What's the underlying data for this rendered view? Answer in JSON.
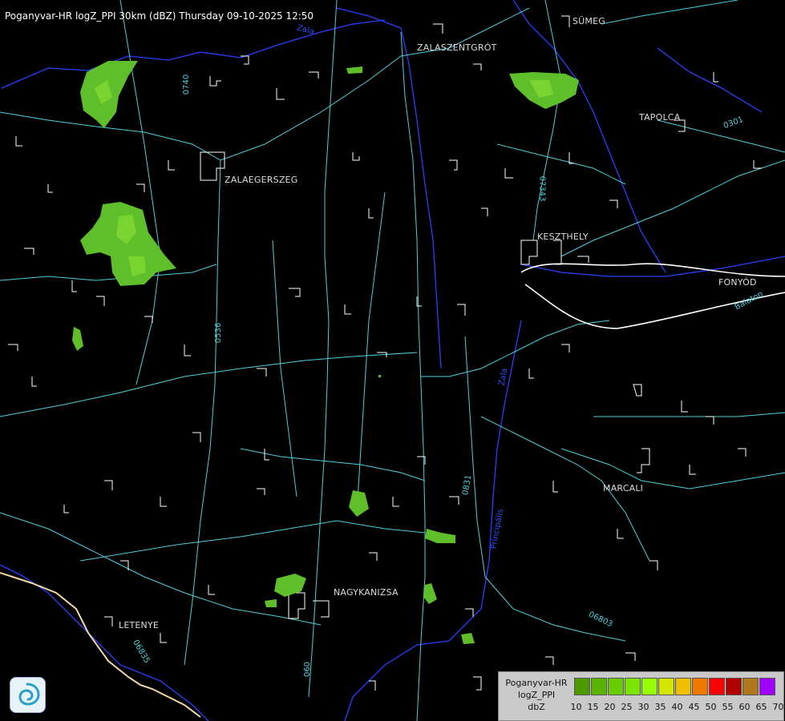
{
  "title": "Poganyvar-HR logZ_PPI 30km (dBZ) Thursday 09-10-2025 12:50",
  "cities": [
    {
      "id": "sumeg",
      "label": "SÜMEG"
    },
    {
      "id": "zalaszentgrot",
      "label": "ZALASZENTGRÓT"
    },
    {
      "id": "tapolca",
      "label": "TAPOLCA"
    },
    {
      "id": "zalaegerszeg",
      "label": "ZALAEGERSZEG"
    },
    {
      "id": "keszthely",
      "label": "KESZTHELY"
    },
    {
      "id": "fonyod",
      "label": "FONYÓD"
    },
    {
      "id": "marcali",
      "label": "MARCALI"
    },
    {
      "id": "nagykanizsa",
      "label": "NAGYKANIZSA"
    },
    {
      "id": "letenye",
      "label": "LETENYE"
    }
  ],
  "road_labels": [
    "0740",
    "07343",
    "0301",
    "0536",
    "0831",
    "06803",
    "06835",
    "060",
    "Balaton"
  ],
  "river_labels": [
    "Zala",
    "Zala",
    "Principális"
  ],
  "legend": {
    "line1": "Poganyvar-HR",
    "line2": "logZ_PPI",
    "line3": "dbZ",
    "levels": [
      {
        "value": "10",
        "color": "#4a9a00"
      },
      {
        "value": "15",
        "color": "#58b400"
      },
      {
        "value": "20",
        "color": "#66cc00"
      },
      {
        "value": "25",
        "color": "#7ae600"
      },
      {
        "value": "30",
        "color": "#96ff00"
      },
      {
        "value": "35",
        "color": "#d4e600"
      },
      {
        "value": "40",
        "color": "#f0c000"
      },
      {
        "value": "45",
        "color": "#f07800"
      },
      {
        "value": "50",
        "color": "#ff0000"
      },
      {
        "value": "55",
        "color": "#b00000"
      },
      {
        "value": "60",
        "color": "#b07818"
      },
      {
        "value": "65",
        "color": "#a000ff"
      },
      {
        "value": "70",
        "color": "#b0b0ff"
      }
    ]
  },
  "colors": {
    "background": "#000000",
    "roads": "#4fd1d9",
    "rivers": "#2a40ff",
    "settlements": "#ffffff",
    "border": "#f0d8a8",
    "echo": "#5fbf2a"
  }
}
